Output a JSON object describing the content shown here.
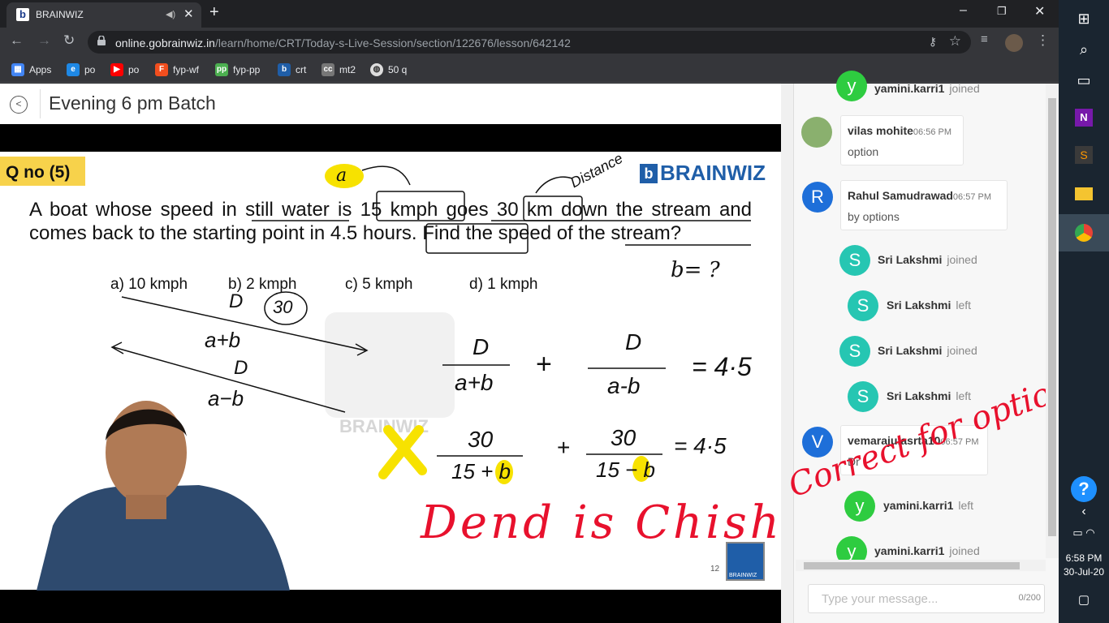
{
  "browser": {
    "tab_title": "BRAINWIZ",
    "url_host": "online.gobrainwiz.in",
    "url_path": "/learn/home/CRT/Today-s-Live-Session/section/122676/lesson/642142",
    "bookmarks": [
      {
        "label": "Apps",
        "icon": "apps-grid-icon",
        "color": "#4285f4"
      },
      {
        "label": "po",
        "icon": "ie-icon",
        "color": "#1e88e5"
      },
      {
        "label": "po",
        "icon": "youtube-icon",
        "color": "#ff0000"
      },
      {
        "label": "fyp-wf",
        "icon": "figma-icon",
        "color": "#f24e1e"
      },
      {
        "label": "fyp-pp",
        "icon": "pp-icon",
        "color": "#4caf50"
      },
      {
        "label": "crt",
        "icon": "brainwiz-icon",
        "color": "#1f5ea8"
      },
      {
        "label": "mt2",
        "icon": "cc-icon",
        "color": "#777777"
      },
      {
        "label": "50 q",
        "icon": "globe-icon",
        "color": "#dddddd"
      }
    ]
  },
  "page": {
    "title": "Evening 6 pm Batch"
  },
  "slide": {
    "qno": "Q no (5)",
    "brand": "BRAINWIZ",
    "question": "A boat whose speed in still water is 15 kmph goes 30 km down the stream and comes back to the starting point in 4.5 hours. Find the speed of the stream?",
    "options": [
      "a) 10 kmph",
      "b) 2 kmph",
      "c) 5 kmph",
      "d) 1 kmph"
    ],
    "watermark": "BRAINWIZ",
    "slide_number": "12",
    "corner_logo": "BRAINWIZ",
    "annotations": {
      "a_circle": "a",
      "distance": "Distance",
      "b_eq": "b= ?",
      "d": "D",
      "thirty": "30",
      "a_plus_b": "a+b",
      "d2": "D",
      "a_minus_b": "a−b",
      "frac1_num": "D",
      "frac1_den": "a+b",
      "plus1": "+",
      "frac2_num": "D",
      "frac2_den": "a-b",
      "eq1": "= 4·5",
      "frac3_num": "30",
      "frac3_den": "15 + b",
      "plus2": "+",
      "frac4_num": "30",
      "frac4_den": "15 − b",
      "eq2": "= 4·5",
      "red_note": "Dend is Chishing!",
      "red_note2": "Correct for option"
    }
  },
  "chat": {
    "entries": [
      {
        "kind": "event",
        "name": "yamini.karri1",
        "action": "joined",
        "avatar": "y",
        "color": "#2ecc40"
      },
      {
        "kind": "message",
        "name": "vilas mohite",
        "time": "06:56 PM",
        "text": "option",
        "avatar": "photo"
      },
      {
        "kind": "message",
        "name": "Rahul Samudrawad",
        "time": "06:57 PM",
        "text": "by options",
        "avatar": "R",
        "color": "#1e6fd9"
      },
      {
        "kind": "event",
        "name": "Sri Lakshmi",
        "action": "joined",
        "avatar": "S",
        "color": "#26c6b2"
      },
      {
        "kind": "event",
        "name": "Sri Lakshmi",
        "action": "left",
        "avatar": "S",
        "color": "#26c6b2"
      },
      {
        "kind": "event",
        "name": "Sri Lakshmi",
        "action": "joined",
        "avatar": "S",
        "color": "#26c6b2"
      },
      {
        "kind": "event",
        "name": "Sri Lakshmi",
        "action": "left",
        "avatar": "S",
        "color": "#26c6b2"
      },
      {
        "kind": "message",
        "name": "vemarajulasrta10",
        "time": "06:57 PM",
        "text": "Dr",
        "avatar": "V",
        "color": "#1e6fd9"
      },
      {
        "kind": "event",
        "name": "yamini.karri1",
        "action": "left",
        "avatar": "y",
        "color": "#2ecc40"
      },
      {
        "kind": "event",
        "name": "yamini.karri1",
        "action": "joined",
        "avatar": "y",
        "color": "#2ecc40"
      }
    ],
    "input_placeholder": "Type your message...",
    "char_count": "0/200"
  },
  "taskbar": {
    "time": "6:58 PM",
    "date": "30-Jul-20"
  }
}
